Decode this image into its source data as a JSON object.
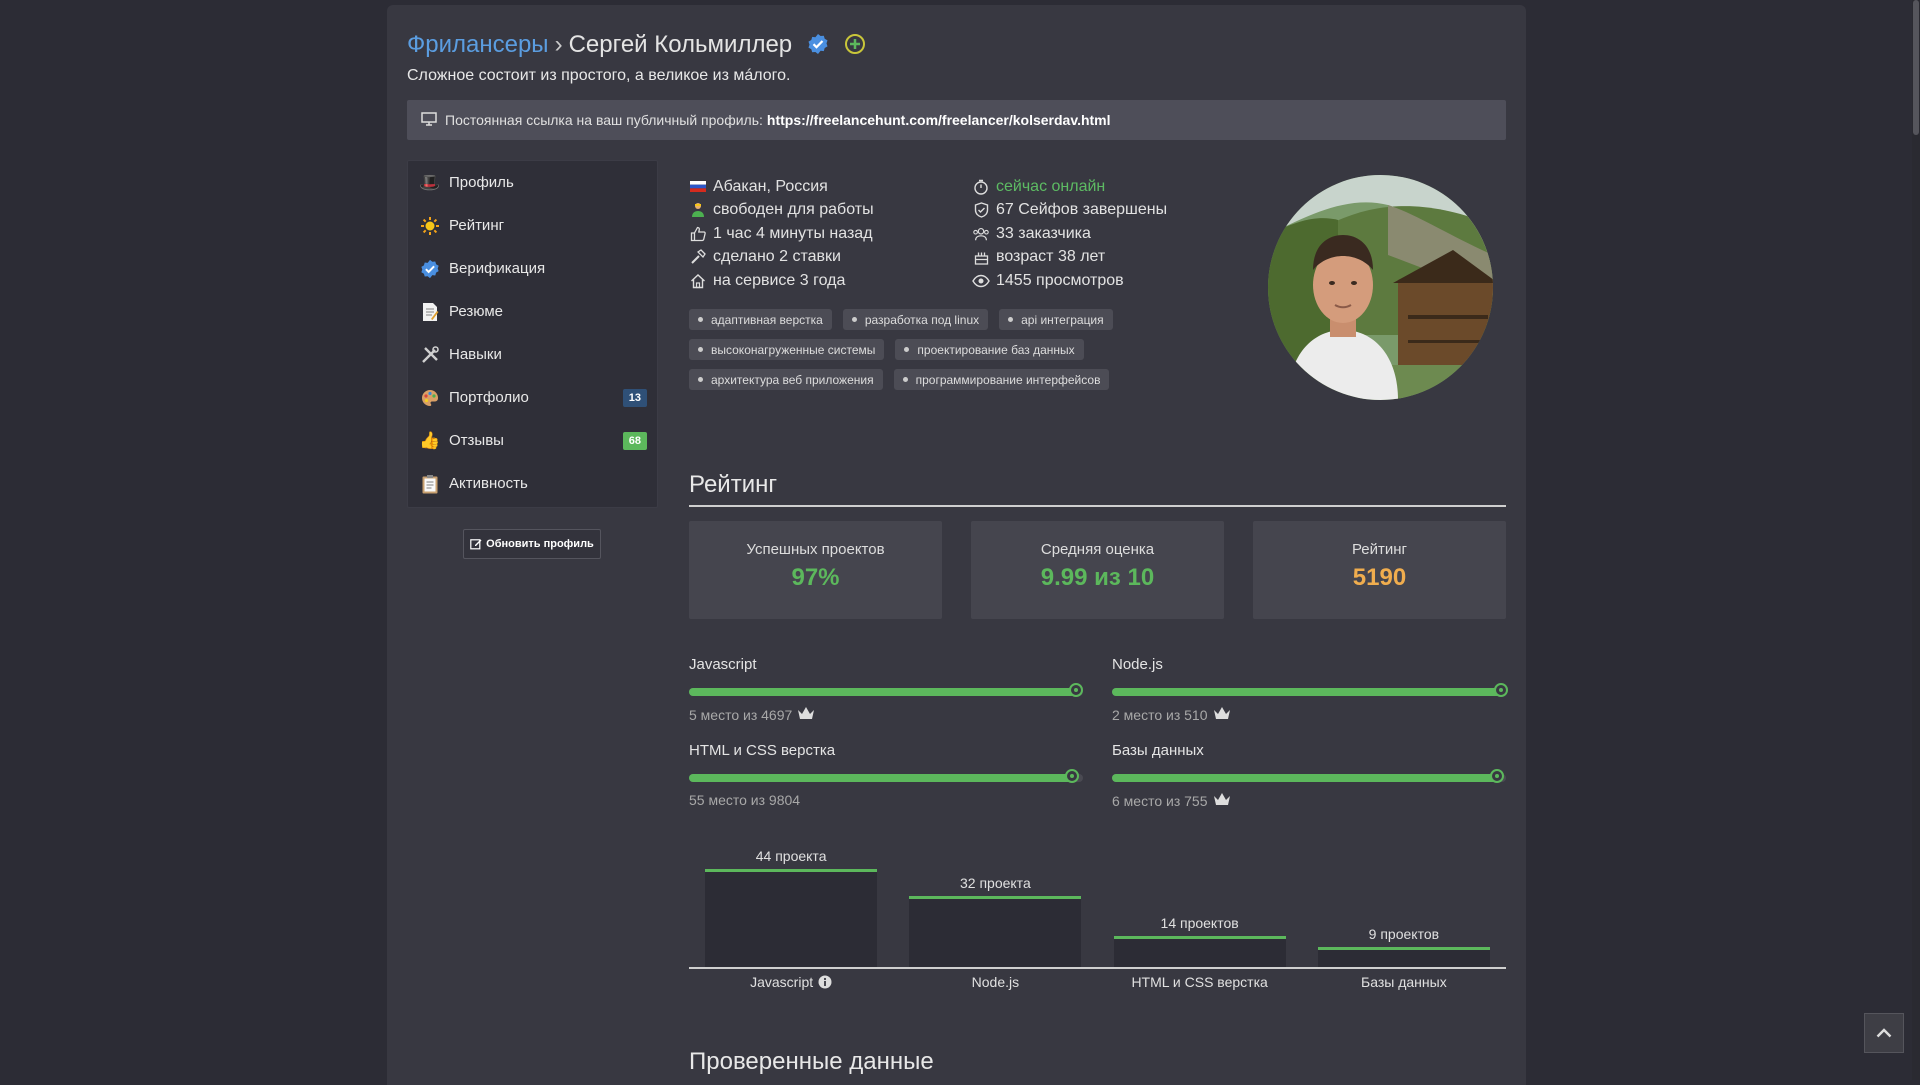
{
  "breadcrumb": {
    "parent": "Фрилансеры",
    "separator": "›",
    "name": "Сергей Кольмиллер"
  },
  "tagline": "Сложное состоит из простого, а великое из мáлого.",
  "permalink": {
    "label": "Постоянная ссылка на ваш публичный профиль:",
    "url": "https://freelancehunt.com/freelancer/kolserdav.html"
  },
  "sidebar": {
    "items": [
      {
        "label": "Профиль",
        "icon": "profile-icon"
      },
      {
        "label": "Рейтинг",
        "icon": "sun-icon"
      },
      {
        "label": "Верификация",
        "icon": "verified-icon"
      },
      {
        "label": "Резюме",
        "icon": "resume-icon"
      },
      {
        "label": "Навыки",
        "icon": "tools-icon"
      },
      {
        "label": "Портфолио",
        "icon": "palette-icon",
        "badge": "13",
        "badge_color": "#2f5077"
      },
      {
        "label": "Отзывы",
        "icon": "thumbs-up-icon",
        "badge": "68",
        "badge_color": "#5cb85c"
      },
      {
        "label": "Активность",
        "icon": "clipboard-icon"
      }
    ],
    "update_button": "Обновить профиль"
  },
  "info": {
    "left": [
      {
        "text": "Абакан, Россия",
        "icon": "flag-russia-icon"
      },
      {
        "text": "свободен для работы",
        "icon": "worker-icon"
      },
      {
        "text": "1 час 4 минуты назад",
        "icon": "thumbs-up-icon"
      },
      {
        "text": "сделано 2 ставки",
        "icon": "hammer-icon"
      },
      {
        "text": "на сервисе 3 года",
        "icon": "home-icon"
      }
    ],
    "right": [
      {
        "text": "сейчас онлайн",
        "icon": "stopwatch-icon"
      },
      {
        "text": "67 Сейфов завершены",
        "icon": "shield-check-icon"
      },
      {
        "text": "33 заказчика",
        "icon": "users-icon"
      },
      {
        "text": "возраст 38 лет",
        "icon": "cake-icon"
      },
      {
        "text": "1455 просмотров",
        "icon": "eye-icon"
      }
    ]
  },
  "tags": [
    [
      "адаптивная верстка",
      "разработка под linux",
      "api интеграция"
    ],
    [
      "высоконагруженные системы",
      "проектирование баз данных"
    ],
    [
      "архитектура веб приложения",
      "программирование интерфейсов"
    ]
  ],
  "rating_section": {
    "title": "Рейтинг",
    "stats": [
      {
        "label": "Успешных проектов",
        "value": "97%",
        "color": "#5cb85c"
      },
      {
        "label": "Средняя оценка",
        "value": "9.99 из 10",
        "color": "#5cb85c"
      },
      {
        "label": "Рейтинг",
        "value": "5190",
        "color": "#f0ad4e"
      }
    ],
    "skills": [
      {
        "name": "Javascript",
        "rank": "5 место из 4697",
        "level": 0.99,
        "crown": true
      },
      {
        "name": "Node.js",
        "rank": "2 место из 510",
        "level": 0.995,
        "crown": true
      },
      {
        "name": "HTML и CSS верстка",
        "rank": "55 место из 9804",
        "level": 0.98,
        "crown": false
      },
      {
        "name": "Базы данных",
        "rank": "6 место из 755",
        "level": 0.985,
        "crown": true
      }
    ]
  },
  "chart_data": {
    "type": "bar",
    "categories": [
      "Javascript",
      "Node.js",
      "HTML и CSS верстка",
      "Базы данных"
    ],
    "values": [
      44,
      32,
      14,
      9
    ],
    "data_labels": [
      "44 проекта",
      "32 проекта",
      "14 проектов",
      "9 проектов"
    ],
    "ylim": [
      0,
      44
    ]
  },
  "verified_section": {
    "title": "Проверенные данные"
  },
  "colors": {
    "accent_green": "#5cb85c",
    "link_blue": "#5b9de0",
    "rating_orange": "#f0ad4e"
  }
}
